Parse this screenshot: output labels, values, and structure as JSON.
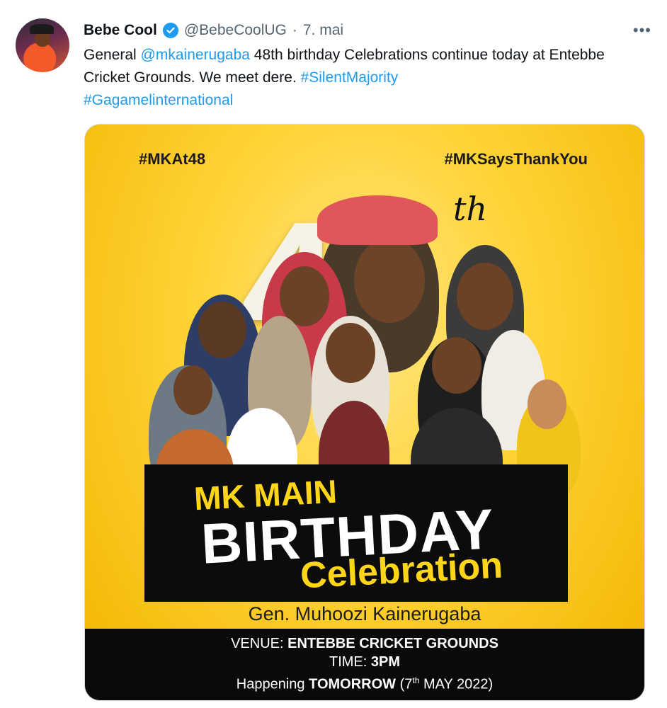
{
  "tweet": {
    "author_name": "Bebe Cool",
    "handle": "@BebeCoolUG",
    "separator": "·",
    "date": "7. mai",
    "more_label": "•••",
    "text_prefix": "General ",
    "mention": "@mkainerugaba",
    "text_middle": "  48th birthday Celebrations  continue today at Entebbe Cricket Grounds. We meet dere. ",
    "hashtag1": "#SilentMajority",
    "hashtag2": "#Gagamelinternational"
  },
  "poster": {
    "hashtag_left": "#MKAt48",
    "hashtag_right": "#MKSaysThankYou",
    "number": "48",
    "suffix": "th",
    "line1": "MK MAIN",
    "line2": "BIRTHDAY",
    "line3": "Celebration",
    "host": "Gen. Muhoozi Kainerugaba",
    "venue_label": "VENUE:",
    "venue": "ENTEBBE CRICKET GROUNDS",
    "time_label": "TIME:",
    "time": "3PM",
    "happening_label": "Happening",
    "happening_when": "TOMORROW",
    "date_open": "(7",
    "date_sup": "th",
    "date_close": " MAY 2022)"
  },
  "colors": {
    "accent": "#1d9bf0",
    "poster_yellow": "#ffd233",
    "banner_black": "#0c0c0c",
    "banner_yellow": "#ffd51a"
  },
  "icons": [
    "verified-badge-icon",
    "more-options-icon"
  ]
}
